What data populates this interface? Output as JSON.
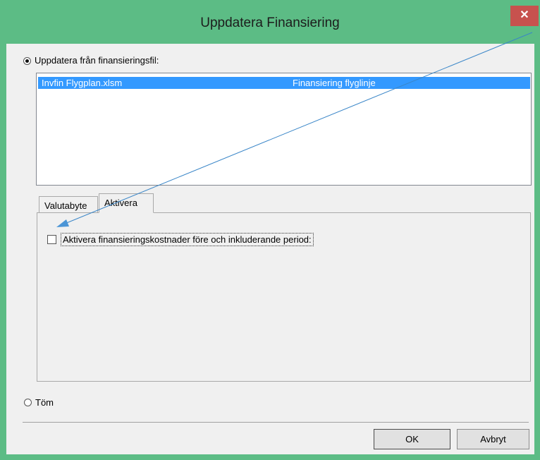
{
  "dialog": {
    "title": "Uppdatera Finansiering",
    "close_glyph": "✕"
  },
  "options": {
    "update_from_file_label": "Uppdatera från finansieringsfil:",
    "update_from_file_checked": true,
    "empty_label": "Töm",
    "empty_checked": false
  },
  "file_list": [
    {
      "file": "Invfin Flygplan.xlsm",
      "description": "Finansiering flyglinje",
      "selected": true
    }
  ],
  "tabs": [
    {
      "label": "Valutabyte",
      "active": false
    },
    {
      "label": "Aktivera",
      "active": true
    }
  ],
  "activate_tab": {
    "checkbox_label": "Aktivera finansieringskostnader före och inkluderande period:",
    "checked": false
  },
  "buttons": {
    "ok": "OK",
    "cancel": "Avbryt"
  },
  "colors": {
    "title_bar": "#5cbc85",
    "close_button": "#c7524e",
    "selection": "#3399ff",
    "annotation_arrow": "#3a86c8"
  }
}
